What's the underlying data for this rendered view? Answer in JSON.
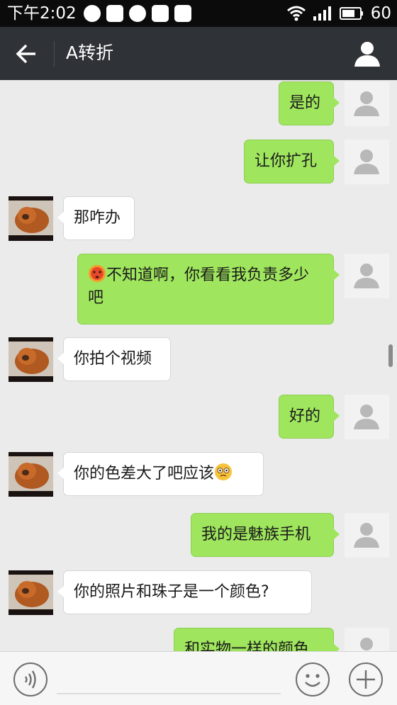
{
  "status_bar": {
    "time": "下午2:02",
    "battery": "60",
    "icons": [
      "chat-bubble-icon",
      "weibo-icon",
      "aperture-icon",
      "qq-penguin-icon",
      "sms-icon",
      "wifi-icon",
      "signal-icon",
      "battery-icon"
    ]
  },
  "header": {
    "title": "A转折",
    "back_icon": "back-arrow-icon",
    "profile_icon": "person-icon"
  },
  "messages": [
    {
      "sender": "me",
      "text": "是的"
    },
    {
      "sender": "me",
      "text": "让你扩孔"
    },
    {
      "sender": "peer",
      "text": "那咋办"
    },
    {
      "sender": "me",
      "emoji": "flushed-face-emoji",
      "text": "不知道啊，你看看我负责多少吧"
    },
    {
      "sender": "peer",
      "text": "你拍个视频"
    },
    {
      "sender": "me",
      "text": "好的"
    },
    {
      "sender": "peer",
      "text": "你的色差大了吧应该",
      "emoji": "dizzy-face-emoji"
    },
    {
      "sender": "me",
      "text": "我的是魅族手机"
    },
    {
      "sender": "peer",
      "text": "你的照片和珠子是一个颜色?"
    },
    {
      "sender": "me",
      "text": "和实物一样的颜色"
    }
  ],
  "input_bar": {
    "voice_icon": "voice-icon",
    "emoji_icon": "smiley-icon",
    "plus_icon": "plus-icon"
  },
  "colors": {
    "sent_bubble": "#9fe65e",
    "received_bubble": "#ffffff",
    "chat_background": "#ebebeb",
    "header": "#2f3236"
  }
}
